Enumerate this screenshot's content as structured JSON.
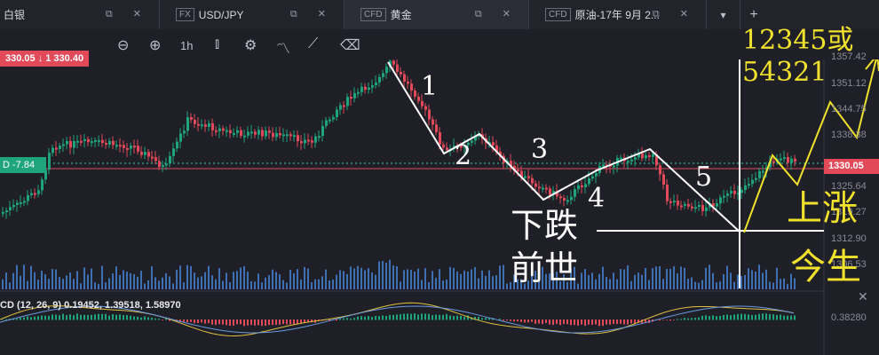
{
  "tabs": [
    {
      "tag": "",
      "label": "白银"
    },
    {
      "tag": "FX",
      "label": "USD/JPY"
    },
    {
      "tag": "CFD",
      "label": "黄金"
    },
    {
      "tag": "CFD",
      "label": "原油-17年 9月 2..."
    }
  ],
  "tab_controls": "⧉ ✕",
  "tab_new": "+",
  "tab_dropdown": "▾",
  "toolbar": {
    "bid_ask": "330.05 ↓ 1 330.40",
    "timeframe": "1h"
  },
  "price_axis": {
    "labels": [
      "1357.42",
      "1351.12",
      "1344.75",
      "1338.38",
      "1325.64",
      "1319.27",
      "1312.90",
      "1306.53"
    ],
    "current": "1330.05",
    "macd_level": "0.38280"
  },
  "left_badge": "D -7.84",
  "macd": {
    "label": "CD (12, 26, 9) 0.19452, 1.39518, 1.58970"
  },
  "annotations": {
    "w1": "1",
    "w2": "2",
    "w3": "3",
    "w4": "4",
    "w5": "5",
    "down_line1": "下跌",
    "down_line2": "前世",
    "pattern": "12345或54321",
    "up_line1": "上涨",
    "up_line2": "今生"
  },
  "colors": {
    "up": "#1fa57c",
    "down": "#e24a5a",
    "annotation": "#f0e22c",
    "background": "#1f1f27"
  }
}
